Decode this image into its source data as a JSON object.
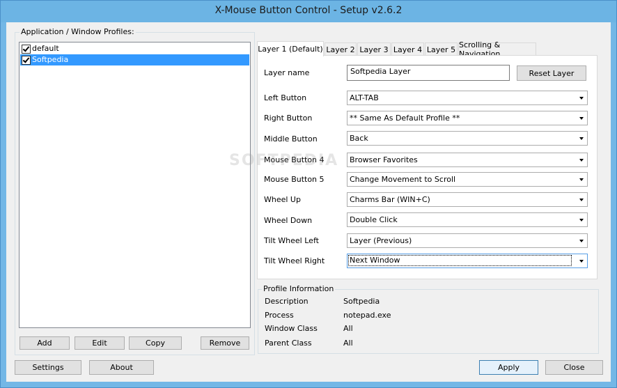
{
  "window": {
    "title": "X-Mouse Button Control - Setup v2.6.2"
  },
  "profiles": {
    "group_label": "Application / Window Profiles:",
    "items": [
      {
        "label": "default",
        "checked": true,
        "selected": false
      },
      {
        "label": "Softpedia",
        "checked": true,
        "selected": true
      }
    ],
    "buttons": {
      "add": "Add",
      "edit": "Edit",
      "copy": "Copy",
      "remove": "Remove"
    }
  },
  "tabs": [
    {
      "label": "Layer 1 (Default)",
      "active": true
    },
    {
      "label": "Layer 2",
      "active": false
    },
    {
      "label": "Layer 3",
      "active": false
    },
    {
      "label": "Layer 4",
      "active": false
    },
    {
      "label": "Layer 5",
      "active": false
    },
    {
      "label": "Scrolling & Navigation",
      "active": false
    }
  ],
  "layer": {
    "name_label": "Layer name",
    "name_value": "Softpedia Layer",
    "reset_button": "Reset Layer",
    "mappings": [
      {
        "label": "Left Button",
        "value": "ALT-TAB"
      },
      {
        "label": "Right Button",
        "value": "** Same As Default Profile **"
      },
      {
        "label": "Middle Button",
        "value": "Back"
      },
      {
        "label": "Mouse Button 4",
        "value": "Browser Favorites"
      },
      {
        "label": "Mouse Button 5",
        "value": "Change Movement to Scroll"
      },
      {
        "label": "Wheel Up",
        "value": "Charms Bar (WIN+C)"
      },
      {
        "label": "Wheel Down",
        "value": "Double Click"
      },
      {
        "label": "Tilt Wheel Left",
        "value": "Layer (Previous)"
      },
      {
        "label": "Tilt Wheel Right",
        "value": "Next Window"
      }
    ]
  },
  "profile_info": {
    "group_label": "Profile Information",
    "rows": [
      {
        "label": "Description",
        "value": "Softpedia"
      },
      {
        "label": "Process",
        "value": "notepad.exe"
      },
      {
        "label": "Window Class",
        "value": "All"
      },
      {
        "label": "Parent Class",
        "value": "All"
      }
    ]
  },
  "footer": {
    "settings": "Settings",
    "about": "About",
    "apply": "Apply",
    "close": "Close"
  },
  "watermark": "SOFTPEDIA"
}
